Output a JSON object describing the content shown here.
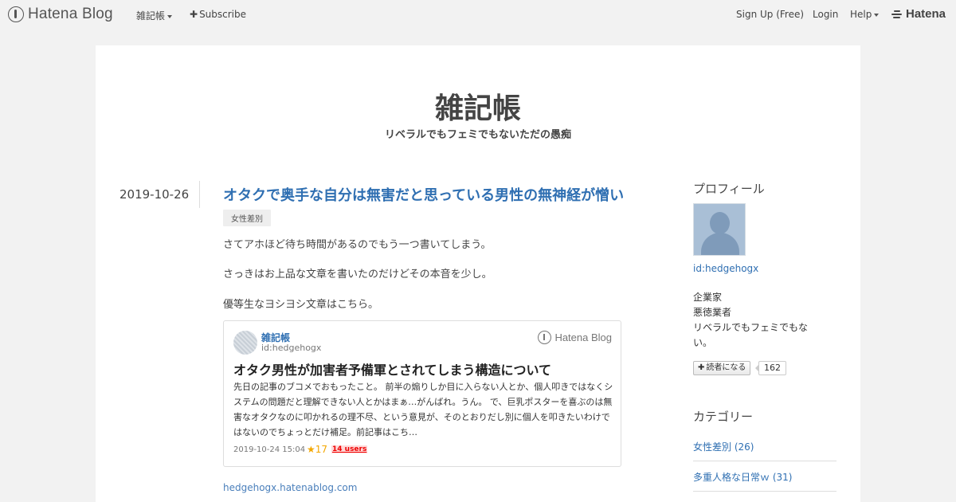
{
  "globalbar": {
    "logo_text": "Hatena Blog",
    "blog_menu": "雑記帳",
    "subscribe": "Subscribe",
    "signup": "Sign Up (Free)",
    "login": "Login",
    "help": "Help",
    "hatena": "Hatena"
  },
  "blog": {
    "title": "雑記帳",
    "description": "リベラルでもフェミでもないただの愚痴"
  },
  "entry": {
    "date": "2019-10-26",
    "title": "オタクで奥手な自分は無害だと思っている男性の無神経が憎い",
    "category": "女性差別",
    "paragraphs": [
      "さてアホほど待ち時間があるのでもう一つ書いてしまう。",
      "さっきはお上品な文章を書いたのだけどその本音を少し。",
      "優等生なヨシヨシ文章はこちら。"
    ],
    "link": "hedgehogx.hatenablog.com"
  },
  "card": {
    "blog_name": "雑記帳",
    "author_id": "id:hedgehogx",
    "brand": "Hatena Blog",
    "title": "オタク男性が加害者予備軍とされてしまう構造について",
    "body": "先日の記事のブコメでおもったこと。 前半の煽りしか目に入らない人とか、個人叩きではなくシステムの問題だと理解できない人とかはまぁ…がんばれ。うん。 で、巨乳ポスターを喜ぶのは無害なオタクなのに叩かれるの理不尽、という意見が、そのとおりだし別に個人を叩きたいわけではないのでちょっとだけ補足。前記事はこち…",
    "date": "2019-10-24 15:04",
    "stars": "★17",
    "users": "14 users"
  },
  "sidebar": {
    "profile_heading": "プロフィール",
    "user_id": "id:hedgehogx",
    "bio_lines": [
      "企業家",
      "悪徳業者",
      "リベラルでもフェミでもな",
      "い。"
    ],
    "reader_button": "読者になる",
    "reader_count": "162",
    "category_heading": "カテゴリー",
    "categories": [
      {
        "label": "女性差別 (26)"
      },
      {
        "label": "多重人格な日常ｗ (31)"
      }
    ]
  },
  "colors": {
    "link": "#2f6fb2",
    "background": "#f2f2f2",
    "panel": "#ffffff"
  }
}
